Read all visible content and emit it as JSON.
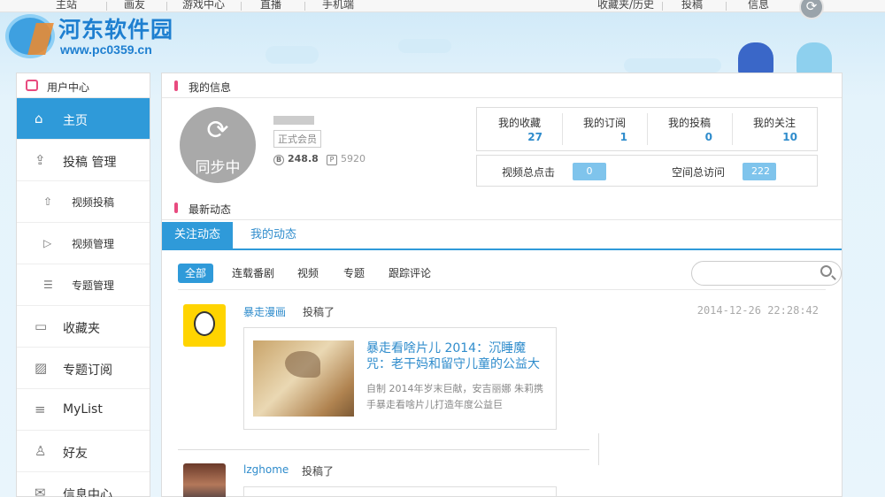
{
  "topnav": {
    "items": [
      "主站",
      "画友",
      "游戏中心",
      "直播",
      "手机端"
    ],
    "right_items": [
      "收藏夹/历史",
      "投稿",
      "信息"
    ]
  },
  "site": {
    "name": "河东软件园",
    "url": "www.pc0359.cn"
  },
  "sidebar": {
    "title": "用户中心",
    "items": [
      {
        "label": "主页",
        "icon": "home-icon",
        "active": true
      },
      {
        "label": "投稿 管理",
        "icon": "upload-box-icon"
      },
      {
        "label": "视频投稿",
        "icon": "upload-icon",
        "sub": true
      },
      {
        "label": "视频管理",
        "icon": "video-icon",
        "sub": true
      },
      {
        "label": "专题管理",
        "icon": "list-doc-icon",
        "sub": true
      },
      {
        "label": "收藏夹",
        "icon": "folder-icon"
      },
      {
        "label": "专题订阅",
        "icon": "image-icon"
      },
      {
        "label": "MyList",
        "icon": "list-icon"
      },
      {
        "label": "好友",
        "icon": "friends-icon"
      },
      {
        "label": "信息中心",
        "icon": "message-icon"
      }
    ]
  },
  "profile": {
    "section_title": "我的信息",
    "avatar_label": "同步中",
    "member_badge": "正式会员",
    "coins": "248.8",
    "points": "5920",
    "stats": [
      {
        "label": "我的收藏",
        "value": "27"
      },
      {
        "label": "我的订阅",
        "value": "1"
      },
      {
        "label": "我的投稿",
        "value": "0"
      },
      {
        "label": "我的关注",
        "value": "10"
      }
    ],
    "totals": [
      {
        "label": "视频总点击",
        "value": "0"
      },
      {
        "label": "空间总访问",
        "value": "222"
      }
    ]
  },
  "feed": {
    "section_title": "最新动态",
    "tabs": [
      "关注动态",
      "我的动态"
    ],
    "filters": [
      "全部",
      "连载番剧",
      "视频",
      "专题",
      "跟踪评论"
    ],
    "search": {
      "placeholder": ""
    },
    "items": [
      {
        "user": "暴走漫画",
        "action": "投稿了",
        "time": "2014-12-26 22:28:42",
        "title": "暴走看啥片儿 2014：沉睡魔咒：老干妈和留守儿童的公益大",
        "desc": "自制 2014年岁末巨献，安吉丽娜 朱莉携手暴走看啥片儿打造年度公益巨"
      },
      {
        "user": "lzghome",
        "action": "投稿了",
        "time": "",
        "title": "",
        "desc": ""
      }
    ]
  },
  "colors": {
    "accent": "#2f9ad9",
    "pink": "#e84b7f",
    "link": "#2f8ccc"
  }
}
